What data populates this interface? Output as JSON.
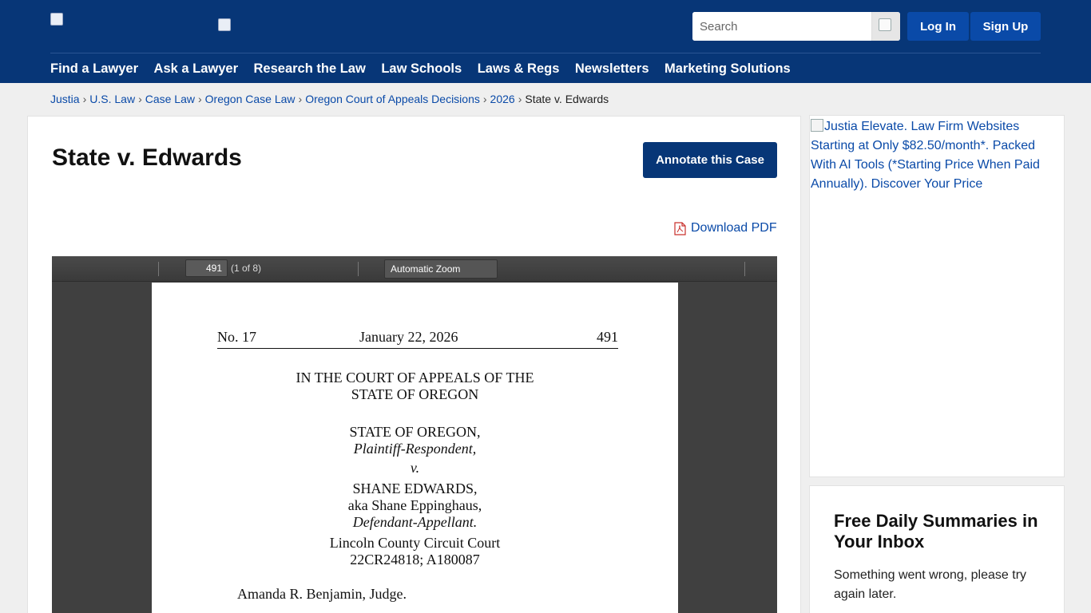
{
  "header": {
    "search_placeholder": "Search",
    "login": "Log In",
    "signup": "Sign Up",
    "nav": [
      "Find a Lawyer",
      "Ask a Lawyer",
      "Research the Law",
      "Law Schools",
      "Laws & Regs",
      "Newsletters",
      "Marketing Solutions"
    ]
  },
  "breadcrumb": {
    "items": [
      "Justia",
      "U.S. Law",
      "Case Law",
      "Oregon Case Law",
      "Oregon Court of Appeals Decisions",
      "2026"
    ],
    "current": "State v. Edwards"
  },
  "case": {
    "title": "State v. Edwards",
    "annotate": "Annotate this Case",
    "download": "Download PDF"
  },
  "viewer": {
    "page_number": "491",
    "page_count": "(1 of 8)",
    "zoom": "Automatic Zoom"
  },
  "document": {
    "number": "No. 17",
    "date": "January 22, 2026",
    "page": "491",
    "court_line1": "IN THE COURT OF APPEALS OF THE",
    "court_line2": "STATE OF OREGON",
    "plaintiff": "STATE OF OREGON,",
    "plaintiff_role": "Plaintiff-Respondent,",
    "versus": "v.",
    "defendant": "SHANE EDWARDS,",
    "defendant_aka": "aka Shane Eppinghaus,",
    "defendant_role": "Defendant-Appellant.",
    "lower_court": "Lincoln County Circuit Court",
    "case_numbers": "22CR24818; A180087",
    "judge": "Amanda R. Benjamin, Judge."
  },
  "sidebar": {
    "ad_text": "Justia Elevate. Law Firm Websites Starting at Only $82.50/month*. Packed With AI Tools (*Starting Price When Paid Annually). Discover Your Price",
    "newsletter_title": "Free Daily Summaries in Your Inbox",
    "newsletter_message": "Something went wrong, please try again later."
  }
}
